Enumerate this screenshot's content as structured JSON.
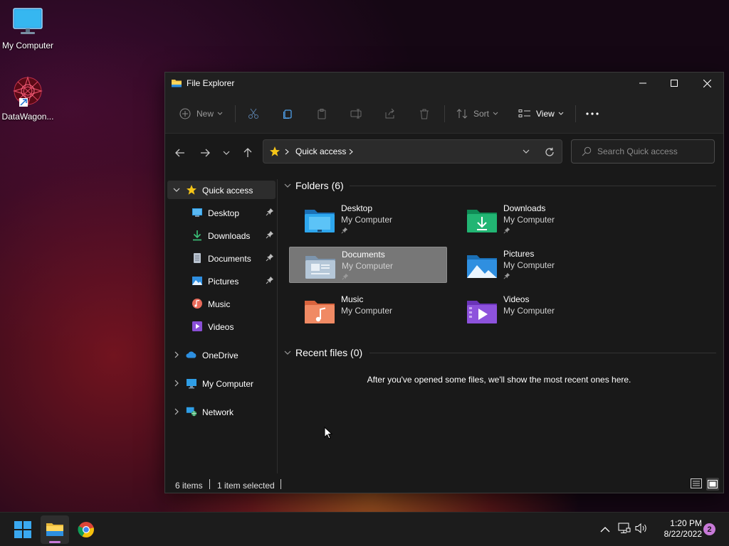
{
  "desktop": {
    "icons": [
      {
        "label": "My Computer",
        "icon": "monitor-icon"
      },
      {
        "label": "DataWagon...",
        "icon": "datawagon-app-icon"
      }
    ]
  },
  "window": {
    "title": "File Explorer",
    "controls": {
      "minimize": "minimize-icon",
      "maximize": "maximize-icon",
      "close": "close-icon"
    }
  },
  "toolbar": {
    "new_label": "New",
    "sort_label": "Sort",
    "view_label": "View",
    "more_icon": "ellipsis-icon"
  },
  "address": {
    "location": "Quick access",
    "search_placeholder": "Search Quick access"
  },
  "sidebar": {
    "quick_access": "Quick access",
    "items": [
      {
        "label": "Desktop",
        "pinned": true
      },
      {
        "label": "Downloads",
        "pinned": true
      },
      {
        "label": "Documents",
        "pinned": true
      },
      {
        "label": "Pictures",
        "pinned": true
      },
      {
        "label": "Music",
        "pinned": false
      },
      {
        "label": "Videos",
        "pinned": false
      }
    ],
    "roots": [
      {
        "label": "OneDrive"
      },
      {
        "label": "My Computer"
      },
      {
        "label": "Network"
      }
    ]
  },
  "content": {
    "folders_header": "Folders (6)",
    "folders": [
      {
        "name": "Desktop",
        "location": "My Computer",
        "pinned": true,
        "selected": false
      },
      {
        "name": "Downloads",
        "location": "My Computer",
        "pinned": true,
        "selected": false
      },
      {
        "name": "Documents",
        "location": "My Computer",
        "pinned": true,
        "selected": true
      },
      {
        "name": "Pictures",
        "location": "My Computer",
        "pinned": true,
        "selected": false
      },
      {
        "name": "Music",
        "location": "My Computer",
        "pinned": false,
        "selected": false
      },
      {
        "name": "Videos",
        "location": "My Computer",
        "pinned": false,
        "selected": false
      }
    ],
    "recent_header": "Recent files (0)",
    "recent_empty": "After you've opened some files, we'll show the most recent ones here."
  },
  "statusbar": {
    "items_count": "6 items",
    "selection": "1 item selected"
  },
  "taskbar": {
    "time": "1:20 PM",
    "date": "8/22/2022",
    "notification_count": "2"
  },
  "colors": {
    "accent": "#0078d4",
    "window_bg": "#191919",
    "toolbar_bg": "#202020",
    "selected_tile": "#777777",
    "notification_badge": "#c87ad8"
  }
}
